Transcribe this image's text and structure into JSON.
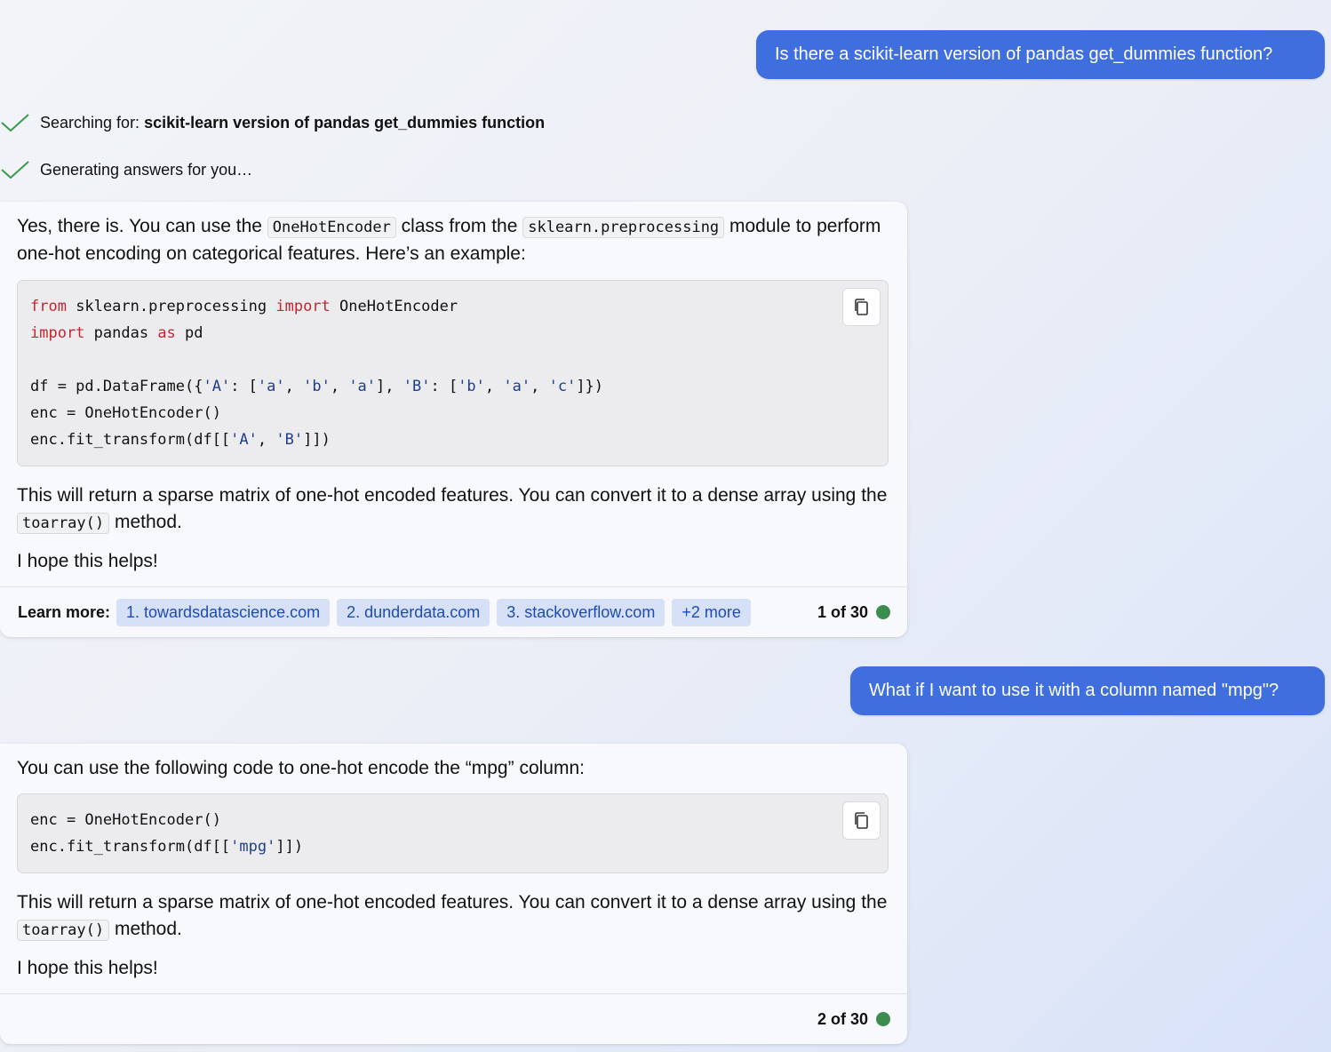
{
  "conversation": {
    "user_message_1": "Is there a scikit-learn version of pandas get_dummies function?",
    "status_search_prefix": "Searching for: ",
    "status_search_query": "scikit-learn version of pandas get_dummies function",
    "status_generating": "Generating answers for you…",
    "response_1": {
      "intro_a": "Yes, there is. You can use the ",
      "intro_code_1": "OneHotEncoder",
      "intro_b": " class from the ",
      "intro_code_2": "sklearn.preprocessing",
      "intro_c": " module to perform one-hot encoding on categorical features. Here’s an example:",
      "code": {
        "l1_kw1": "from",
        "l1_mid": " sklearn.preprocessing ",
        "l1_kw2": "import",
        "l1_end": " OneHotEncoder",
        "l2_kw1": "import",
        "l2_mid": " pandas ",
        "l2_kw2": "as",
        "l2_end": " pd",
        "l4_a": "df = pd.DataFrame({",
        "l4_s1": "'A'",
        "l4_b": ": [",
        "l4_s2": "'a'",
        "l4_c": ", ",
        "l4_s3": "'b'",
        "l4_d": ", ",
        "l4_s4": "'a'",
        "l4_e": "], ",
        "l4_s5": "'B'",
        "l4_f": ": [",
        "l4_s6": "'b'",
        "l4_g": ", ",
        "l4_s7": "'a'",
        "l4_h": ", ",
        "l4_s8": "'c'",
        "l4_i": "]})",
        "l5": "enc = OneHotEncoder()",
        "l6_a": "enc.fit_transform(df[[",
        "l6_s1": "'A'",
        "l6_b": ", ",
        "l6_s2": "'B'",
        "l6_c": "]])"
      },
      "after_a": "This will return a sparse matrix of one-hot encoded features. You can convert it to a dense array using the ",
      "after_code": "toarray()",
      "after_b": " method.",
      "closing": "I hope this helps!",
      "learn_more_label": "Learn more:",
      "links": [
        "1. towardsdatascience.com",
        "2. dunderdata.com",
        "3. stackoverflow.com",
        "+2 more"
      ],
      "counter": "1 of 30"
    },
    "user_message_2": "What if I want to use it with a column named \"mpg\"?",
    "response_2": {
      "intro": "You can use the following code to one-hot encode the “mpg” column:",
      "code": {
        "l1": "enc = OneHotEncoder()",
        "l2_a": "enc.fit_transform(df[[",
        "l2_s1": "'mpg'",
        "l2_b": "]])"
      },
      "after_a": "This will return a sparse matrix of one-hot encoded features. You can convert it to a dense array using the ",
      "after_code": "toarray()",
      "after_b": " method.",
      "closing": "I hope this helps!",
      "counter": "2 of 30"
    }
  },
  "colors": {
    "user_bubble": "#3f6fdf",
    "check": "#3a9c4a",
    "keyword": "#c4252f",
    "string": "#1f3f8a",
    "link_chip_bg": "#d6e0f6",
    "link_text": "#1d4cb8",
    "status_dot": "#3d8c4f"
  },
  "icons": {
    "status": "checkmark-icon",
    "copy": "copy-icon"
  }
}
